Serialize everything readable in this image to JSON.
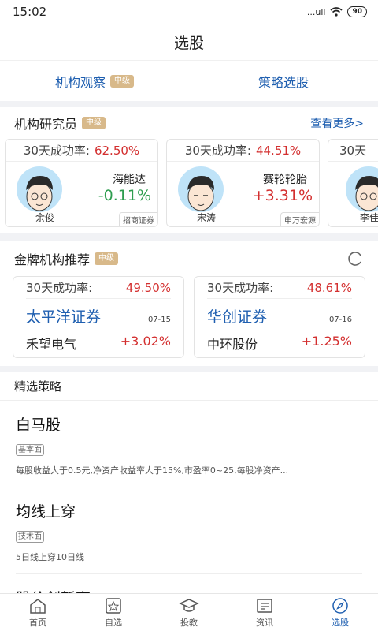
{
  "status": {
    "time": "15:02",
    "signal": "...ull",
    "battery": "90"
  },
  "header": {
    "title": "选股"
  },
  "top_tabs": [
    {
      "label": "机构观察",
      "badge": "中级"
    },
    {
      "label": "策略选股"
    }
  ],
  "researchers": {
    "title": "机构研究员",
    "badge": "中级",
    "more": "查看更多>",
    "cards": [
      {
        "rate_label": "30天成功率:",
        "rate": "62.50%",
        "stock": "海能达",
        "change": "-0.11%",
        "name": "余俊",
        "org": "招商证券"
      },
      {
        "rate_label": "30天成功率:",
        "rate": "44.51%",
        "stock": "赛轮轮胎",
        "change": "+3.31%",
        "name": "宋涛",
        "org": "申万宏源"
      },
      {
        "rate_label": "30天",
        "name": "李佳"
      }
    ]
  },
  "gold": {
    "title": "金牌机构推荐",
    "badge": "中级",
    "cards": [
      {
        "rate_label": "30天成功率:",
        "rate": "49.50%",
        "inst": "太平洋证券",
        "date": "07-15",
        "stock": "禾望电气",
        "change": "+3.02%"
      },
      {
        "rate_label": "30天成功率:",
        "rate": "48.61%",
        "inst": "华创证券",
        "date": "07-16",
        "stock": "中环股份",
        "change": "+1.25%"
      }
    ]
  },
  "strategies": {
    "title": "精选策略",
    "items": [
      {
        "title": "白马股",
        "tag": "基本面",
        "desc": "每股收益大于0.5元,净资产收益率大于15%,市盈率0~25,每股净资产..."
      },
      {
        "title": "均线上穿",
        "tag": "技术面",
        "desc": "5日线上穿10日线"
      },
      {
        "title": "股价创新高"
      }
    ]
  },
  "nav": [
    {
      "label": "首页",
      "icon": "home-icon"
    },
    {
      "label": "自选",
      "icon": "star-icon"
    },
    {
      "label": "投教",
      "icon": "graduation-cap-icon"
    },
    {
      "label": "资讯",
      "icon": "news-icon"
    },
    {
      "label": "选股",
      "icon": "compass-icon",
      "active": true
    }
  ],
  "colors": {
    "accent": "#1f5fb0",
    "up": "#d32f2f",
    "down": "#2e9d4f",
    "badge": "#d8b98a"
  }
}
